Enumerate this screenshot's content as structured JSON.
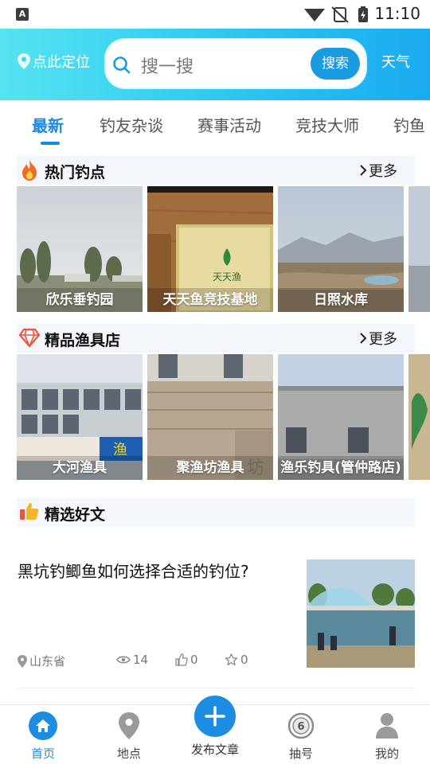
{
  "status_bar": {
    "time": "11:10",
    "notification_badge": "A"
  },
  "header": {
    "location_label": "点此定位",
    "search_placeholder": "搜一搜",
    "search_button": "搜索",
    "weather_label": "天气",
    "gradient_start": "#56e4f2",
    "gradient_end": "#1aaaf0"
  },
  "tabs": [
    {
      "label": "最新",
      "active": true
    },
    {
      "label": "钓友杂谈",
      "active": false
    },
    {
      "label": "赛事活动",
      "active": false
    },
    {
      "label": "竞技大师",
      "active": false
    },
    {
      "label": "钓鱼",
      "active": false
    }
  ],
  "hot_spots": {
    "title": "热门钓点",
    "more": "更多",
    "icon": "flame-icon",
    "items": [
      {
        "name": "欣乐垂钓园"
      },
      {
        "name": "天天鱼竞技基地"
      },
      {
        "name": "日照水库"
      }
    ]
  },
  "shops": {
    "title": "精品渔具店",
    "more": "更多",
    "icon": "diamond-icon",
    "items": [
      {
        "name": "大河渔具"
      },
      {
        "name": "聚渔坊渔具"
      },
      {
        "name": "渔乐钓具(管仲路店)"
      }
    ]
  },
  "articles": {
    "title": "精选好文",
    "icon": "thumbs-up-icon",
    "items": [
      {
        "title": "黑坑钓鲫鱼如何选择合适的钓位?",
        "location": "山东省",
        "views": "14",
        "likes": "0",
        "favorites": "0"
      }
    ]
  },
  "bottom_nav": [
    {
      "label": "首页",
      "icon": "home-icon",
      "active": true
    },
    {
      "label": "地点",
      "icon": "map-pin-icon",
      "active": false
    },
    {
      "label": "发布文章",
      "icon": "plus-icon",
      "active": false
    },
    {
      "label": "抽号",
      "icon": "lottery-ball-icon",
      "active": false
    },
    {
      "label": "我的",
      "icon": "user-icon",
      "active": false
    }
  ],
  "colors": {
    "accent": "#1d88e0",
    "section_bg": "#f3f6fb"
  }
}
